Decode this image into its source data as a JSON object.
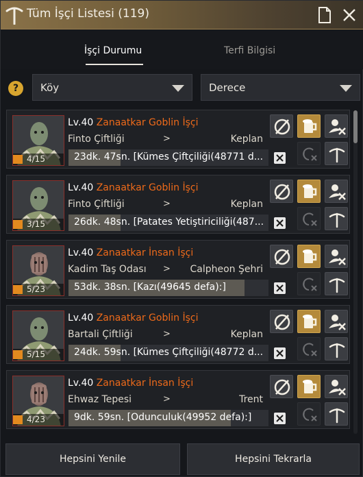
{
  "window": {
    "title": "Tüm İşçi Listesi (119)"
  },
  "tabs": [
    {
      "label": "İşçi Durumu",
      "active": true
    },
    {
      "label": "Terfi Bilgisi",
      "active": false
    }
  ],
  "filters": {
    "help_icon": "?",
    "village_label": "Köy",
    "rank_label": "Derece"
  },
  "workers": [
    {
      "level": "Lv.40",
      "name": "Zanaatkar Goblin İşçi",
      "portrait": "goblin",
      "stamina": "4/15",
      "origin": "Finto Çiftliği",
      "arrow": ">",
      "destination": "Keplan",
      "task": "23dk. 47sn. [Kümes Çiftçiliği(48771 d...",
      "progress": 0.26
    },
    {
      "level": "Lv.40",
      "name": "Zanaatkar Goblin İşçi",
      "portrait": "goblin",
      "stamina": "3/15",
      "origin": "Finto Çiftliği",
      "arrow": ">",
      "destination": "Keplan",
      "task": "26dk. 48sn. [Patates Yetiştiriciliği(487...",
      "progress": 0.26
    },
    {
      "level": "Lv.40",
      "name": "Zanaatkar İnsan İşçi",
      "portrait": "human",
      "stamina": "5/23",
      "origin": "Kadim Taş Odası",
      "arrow": ">",
      "destination": "Calpheon Şehri",
      "task": "53dk. 38sn. [Kazı(49645 defa):]",
      "progress": 0.88
    },
    {
      "level": "Lv.40",
      "name": "Zanaatkar Goblin İşçi",
      "portrait": "goblin",
      "stamina": "5/15",
      "origin": "Bartali Çiftliği",
      "arrow": ">",
      "destination": "Keplan",
      "task": "24dk. 59sn. [Kümes Çiftçiliği(48772 d...",
      "progress": 0.26
    },
    {
      "level": "Lv.40",
      "name": "Zanaatkar İnsan İşçi",
      "portrait": "human",
      "stamina": "4/23",
      "origin": "Ehwaz Tepesi",
      "arrow": ">",
      "destination": "Trent",
      "task": "9dk. 59sn. [Odunculuk(49952 defa):]",
      "progress": 0.81
    }
  ],
  "bottom": {
    "refresh_all": "Hepsini Yenile",
    "repeat_all": "Hepsini Tekrarla"
  },
  "colors": {
    "title_bar": "#8a7248",
    "worker_name": "#ee6a1a",
    "stamina": "#e28a1f",
    "active_button": "#b48a3b"
  }
}
